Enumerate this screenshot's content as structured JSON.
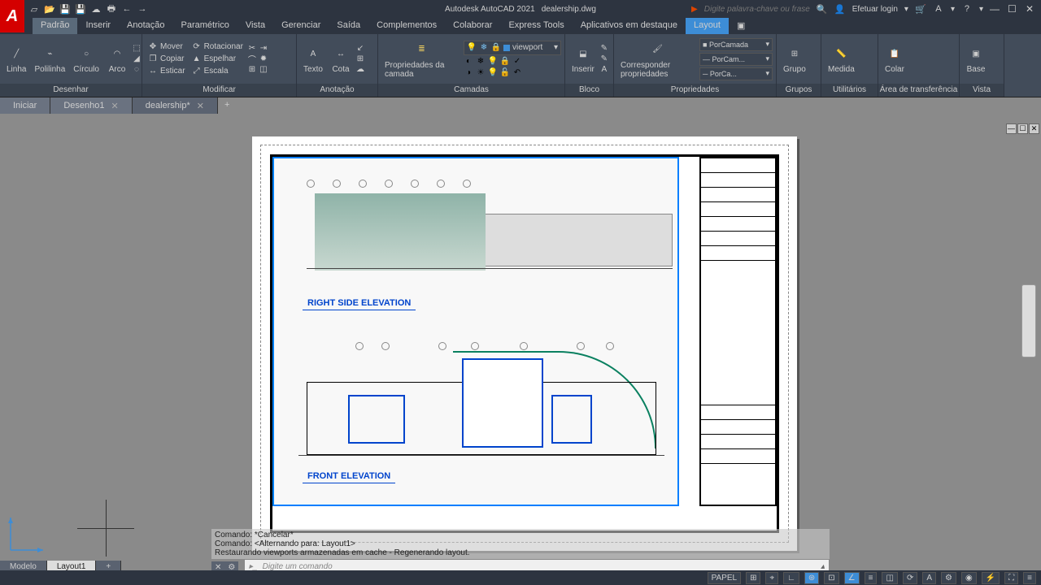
{
  "titlebar": {
    "app": "Autodesk AutoCAD 2021",
    "file": "dealership.dwg",
    "search_placeholder": "Digite palavra-chave ou frase",
    "login": "Efetuar login"
  },
  "menu": {
    "items": [
      "Padrão",
      "Inserir",
      "Anotação",
      "Paramétrico",
      "Vista",
      "Gerenciar",
      "Saída",
      "Complementos",
      "Colaborar",
      "Express Tools",
      "Aplicativos em destaque",
      "Layout"
    ]
  },
  "ribbon": {
    "draw": {
      "linha": "Linha",
      "polilinha": "Polilinha",
      "circulo": "Círculo",
      "arco": "Arco",
      "title": "Desenhar"
    },
    "modify": {
      "mover": "Mover",
      "rotacionar": "Rotacionar",
      "copiar": "Copiar",
      "espelhar": "Espelhar",
      "esticar": "Esticar",
      "escala": "Escala",
      "title": "Modificar"
    },
    "anot": {
      "texto": "Texto",
      "cota": "Cota",
      "title": "Anotação"
    },
    "layers": {
      "btn": "Propriedades da camada",
      "combo_value": "viewport",
      "title": "Camadas"
    },
    "block": {
      "btn": "Inserir",
      "title": "Bloco"
    },
    "props": {
      "btn": "Corresponder propriedades",
      "c1": "PorCamada",
      "c2": "PorCam...",
      "c3": "PorCa...",
      "title": "Propriedades"
    },
    "groups": {
      "btn": "Grupo",
      "title": "Grupos"
    },
    "util": {
      "btn": "Medida",
      "title": "Utilitários"
    },
    "clip": {
      "btn": "Colar",
      "title": "Área de transferência"
    },
    "view": {
      "btn": "Base",
      "title": "Vista"
    }
  },
  "filetabs": {
    "start": "Iniciar",
    "t1": "Desenho1",
    "t2": "dealership*"
  },
  "drawing": {
    "label_right": "RIGHT SIDE ELEVATION",
    "label_front": "FRONT ELEVATION"
  },
  "cmd": {
    "h1": "Comando: *Cancelar*",
    "h2": "Comando:   <Alternando para: Layout1>",
    "h3": "Restaurando viewports armazenadas em cache - Regenerando layout.",
    "prompt": "Digite um comando"
  },
  "layout_tabs": {
    "model": "Modelo",
    "l1": "Layout1"
  },
  "status": {
    "space": "PAPEL"
  }
}
